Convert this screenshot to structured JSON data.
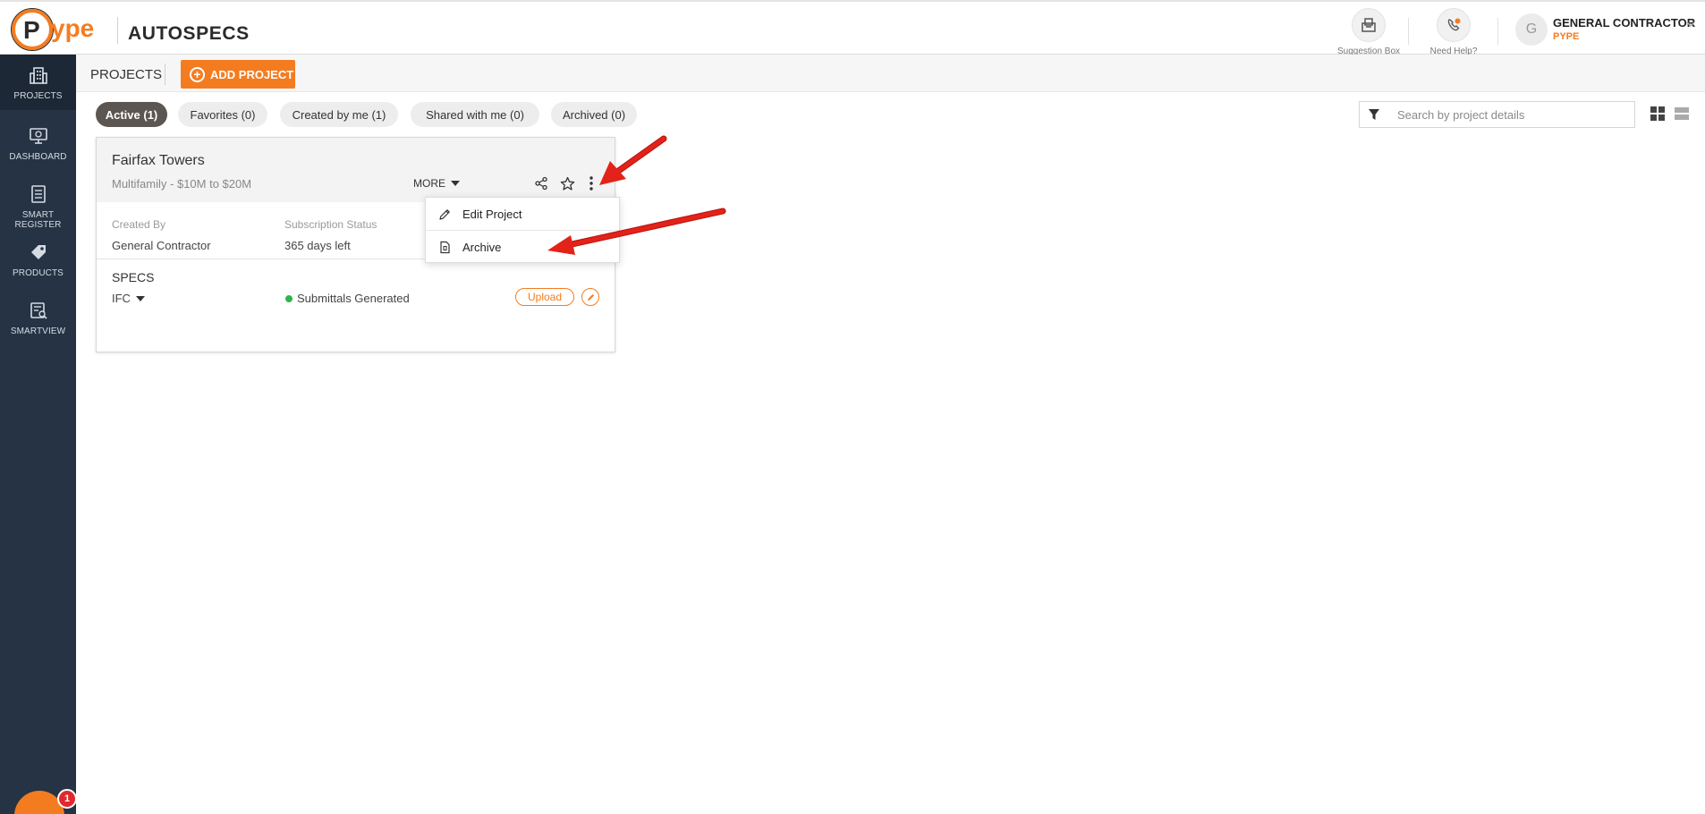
{
  "header": {
    "logo_text": "Pype",
    "app_name": "AUTOSPECS",
    "tools": [
      {
        "label": "Suggestion Box",
        "icon": "suggestion-box-icon"
      },
      {
        "label": "Need Help?",
        "icon": "phone-help-icon"
      }
    ],
    "user": {
      "initial": "G",
      "name": "GENERAL CONTRACTOR",
      "org": "PYPE"
    }
  },
  "sidebar": {
    "items": [
      {
        "label": "PROJECTS",
        "icon": "building-icon",
        "active": true
      },
      {
        "label": "DASHBOARD",
        "icon": "monitor-icon",
        "active": false
      },
      {
        "label": "SMART REGISTER",
        "icon": "register-icon",
        "active": false
      },
      {
        "label": "PRODUCTS",
        "icon": "tag-icon",
        "active": false
      },
      {
        "label": "SMARTVIEW",
        "icon": "smartview-icon",
        "active": false
      }
    ]
  },
  "subheader": {
    "title": "PROJECTS",
    "add_label": "ADD PROJECT"
  },
  "tabs": [
    {
      "label": "Active (1)",
      "active": true
    },
    {
      "label": "Favorites (0)",
      "active": false
    },
    {
      "label": "Created by me (1)",
      "active": false
    },
    {
      "label": "Shared with me (0)",
      "active": false
    },
    {
      "label": "Archived (0)",
      "active": false
    }
  ],
  "search": {
    "placeholder": "Search by project details",
    "value": ""
  },
  "project": {
    "name": "Fairfax Towers",
    "type": "Multifamily",
    "meta_separator": " - ",
    "budget": "$10M to $20M",
    "more_label": "MORE",
    "created_by_label": "Created By",
    "created_by_value": "General Contractor",
    "subscription_label": "Subscription Status",
    "subscription_value": "365 days left",
    "specs_title": "SPECS",
    "specs_version": "IFC",
    "specs_status": "Submittals Generated",
    "upload_label": "Upload"
  },
  "menu": {
    "items": [
      {
        "label": "Edit Project",
        "icon": "pencil-icon"
      },
      {
        "label": "Archive",
        "icon": "archive-file-icon"
      }
    ]
  },
  "chat": {
    "badge_count": "1"
  },
  "colors": {
    "brand_orange": "#f47c20",
    "sidebar_bg": "#253344",
    "active_tab_bg": "#5b5651",
    "status_green": "#2fb54a",
    "annotation_red": "#e32219"
  }
}
